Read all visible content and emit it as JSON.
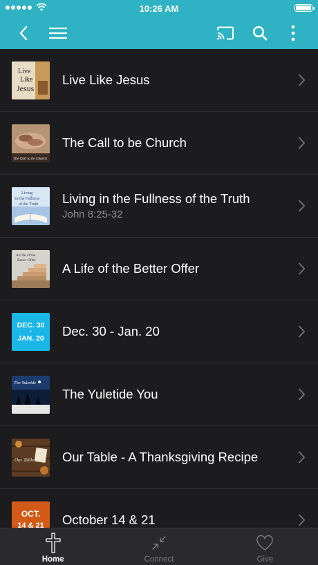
{
  "status": {
    "time": "10:26 AM"
  },
  "items": [
    {
      "title": "Live Like Jesus",
      "subtitle": "",
      "thumb_text": [
        "Live",
        "Like",
        "Jesus"
      ]
    },
    {
      "title": "The Call to be Church",
      "subtitle": "",
      "thumb_text": [
        "The Call to be Church"
      ]
    },
    {
      "title": "Living in the Fullness of the Truth",
      "subtitle": "John 8:25-32",
      "thumb_text": [
        "Living",
        "in the Fullness",
        "of the Truth"
      ]
    },
    {
      "title": "A Life of the Better Offer",
      "subtitle": "",
      "thumb_text": [
        "A Life of the",
        "Better Offer"
      ]
    },
    {
      "title": "Dec. 30 - Jan. 20",
      "subtitle": "",
      "thumb_text": [
        "DEC. 30",
        "-",
        "JAN. 20"
      ]
    },
    {
      "title": "The Yuletide You",
      "subtitle": "",
      "thumb_text": [
        "The Yuletide"
      ]
    },
    {
      "title": "Our Table - A Thanksgiving Recipe",
      "subtitle": "",
      "thumb_text": [
        "Our Table"
      ]
    },
    {
      "title": "October 14 & 21",
      "subtitle": "",
      "thumb_text": [
        "OCT.",
        "14 & 21"
      ]
    }
  ],
  "tabs": [
    {
      "label": "Home",
      "icon": "cross-icon",
      "active": true
    },
    {
      "label": "Connect",
      "icon": "arrows-in-icon",
      "active": false
    },
    {
      "label": "Give",
      "icon": "heart-icon",
      "active": false
    }
  ]
}
